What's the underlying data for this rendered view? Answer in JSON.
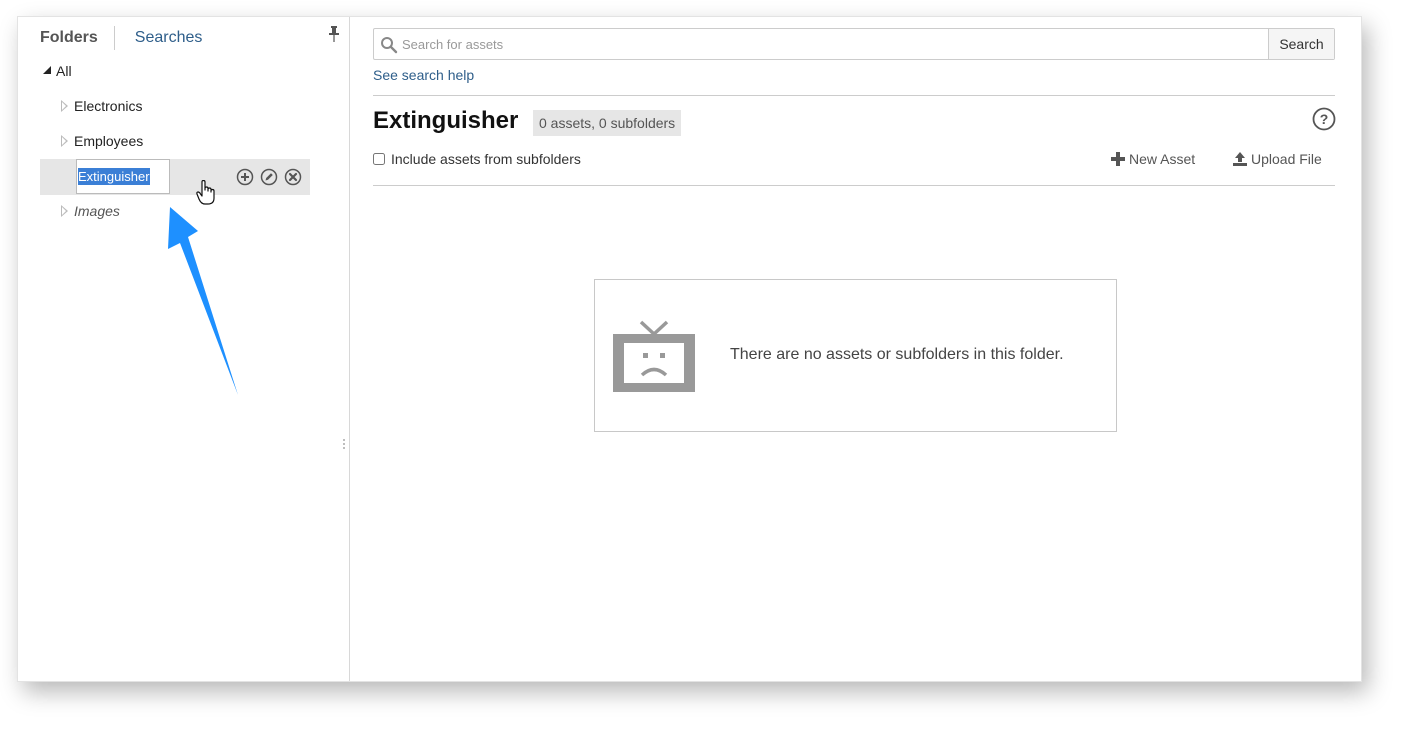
{
  "left_panel": {
    "tabs": {
      "folders": "Folders",
      "searches": "Searches"
    },
    "tree": {
      "root": "All",
      "items": [
        {
          "label": "Electronics",
          "state": "collapsed"
        },
        {
          "label": "Employees",
          "state": "collapsed"
        },
        {
          "label": "Extinguisher",
          "state": "editing"
        },
        {
          "label": "Images",
          "state": "collapsed"
        }
      ],
      "editing_value": "Extinguisher"
    }
  },
  "search": {
    "placeholder": "Search for assets",
    "button": "Search",
    "help_link": "See search help"
  },
  "folder": {
    "title": "Extinguisher",
    "count": "0 assets, 0 subfolders",
    "include_subfolders_label": "Include assets from subfolders",
    "new_asset": "New Asset",
    "upload_file": "Upload File"
  },
  "empty_state": {
    "message": "There are no assets or subfolders in this folder."
  },
  "colors": {
    "link": "#2e5e8a",
    "selection": "#3b7fd6",
    "annotation_arrow": "#1e90ff"
  }
}
